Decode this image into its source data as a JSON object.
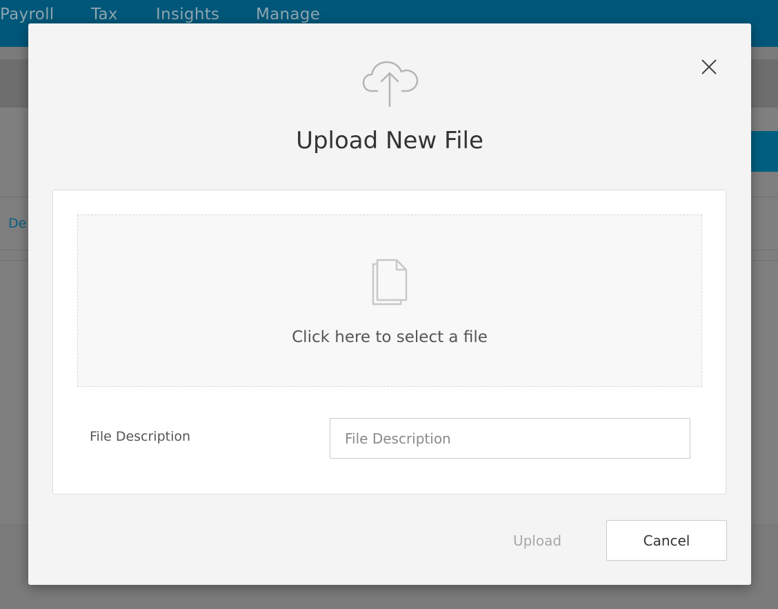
{
  "nav": {
    "items": [
      {
        "label": "Payroll"
      },
      {
        "label": "Tax"
      },
      {
        "label": "Insights"
      },
      {
        "label": "Manage"
      }
    ]
  },
  "background": {
    "link_fragment": "De"
  },
  "modal": {
    "title": "Upload New File",
    "icons": {
      "header": "cloud-upload-icon",
      "close": "close-icon",
      "file": "document-icon"
    },
    "dropzone": {
      "text": "Click here to select a file"
    },
    "description": {
      "label": "File Description",
      "placeholder": "File Description",
      "value": ""
    },
    "buttons": {
      "upload_label": "Upload",
      "cancel_label": "Cancel"
    }
  },
  "colors": {
    "nav_bg": "#00577a",
    "modal_bg": "#f4f4f4",
    "card_bg": "#ffffff",
    "disabled_text": "#a7a7a7"
  }
}
